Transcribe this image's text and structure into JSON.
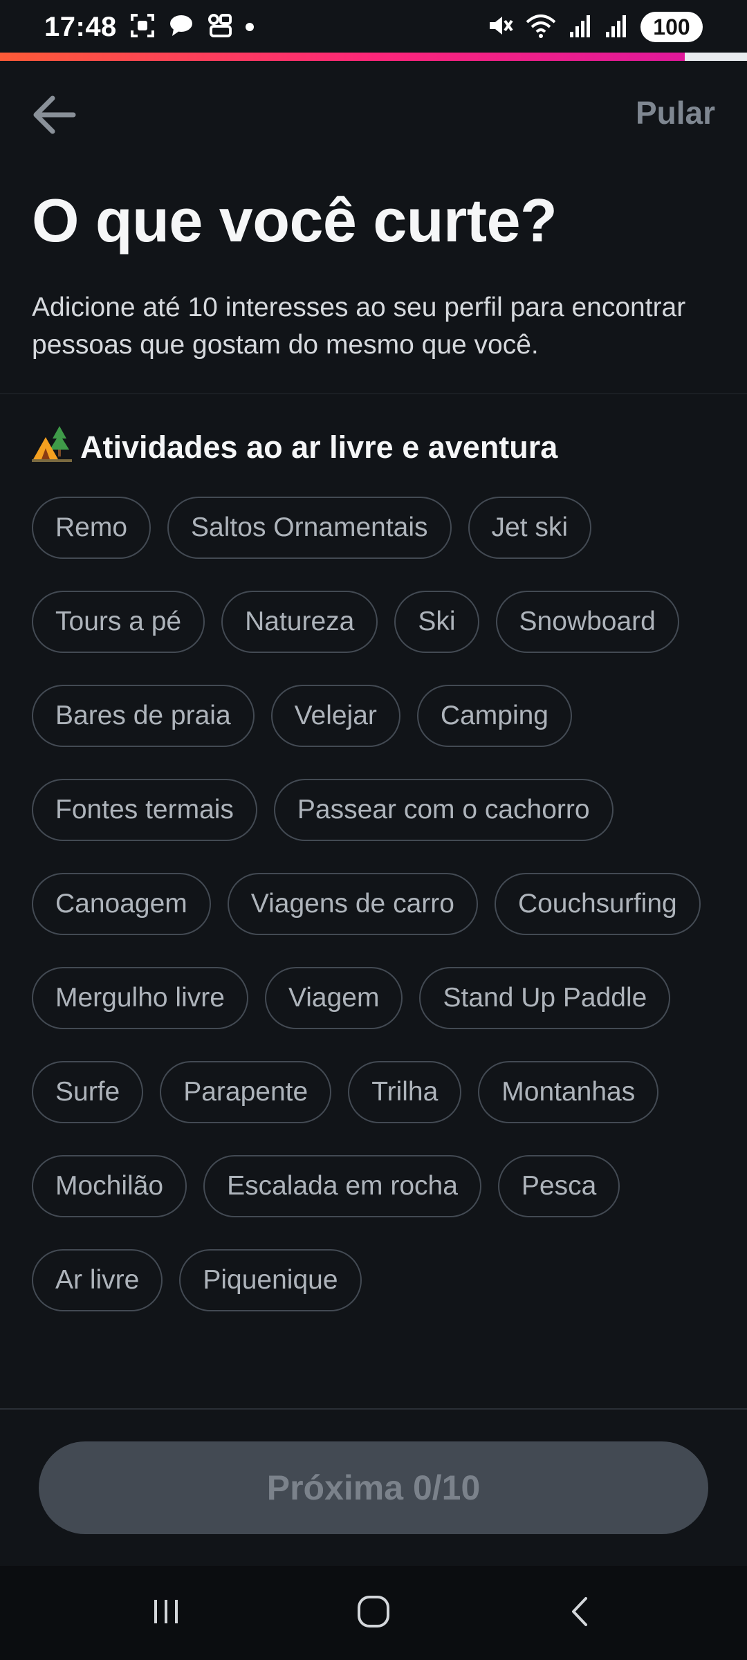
{
  "status_bar": {
    "time": "17:48",
    "battery": "100",
    "icons": [
      "screenshot-icon",
      "chat-bubble-icon",
      "app-switch-icon",
      "mute-icon",
      "wifi-icon",
      "signal-icon",
      "signal-icon"
    ]
  },
  "progress": {
    "fraction": 0.917
  },
  "header": {
    "back_icon": "arrow-left-icon",
    "skip_label": "Pular",
    "title": "O que você curte?",
    "subtitle": "Adicione até 10 interesses ao seu perfil para encontrar pessoas que gostam do mesmo que você."
  },
  "section": {
    "emoji": "camping-icon",
    "heading": "Atividades ao ar livre e aventura",
    "chips": [
      "Remo",
      "Saltos Ornamentais",
      "Jet ski",
      "Tours a pé",
      "Natureza",
      "Ski",
      "Snowboard",
      "Bares de praia",
      "Velejar",
      "Camping",
      "Fontes termais",
      "Passear com o cachorro",
      "Canoagem",
      "Viagens de carro",
      "Couchsurfing",
      "Mergulho livre",
      "Viagem",
      "Stand Up Paddle",
      "Surfe",
      "Parapente",
      "Trilha",
      "Montanhas",
      "Mochilão",
      "Escalada em rocha",
      "Pesca",
      "Ar livre",
      "Piquenique"
    ]
  },
  "footer": {
    "next_label": "Próxima 0/10"
  },
  "colors": {
    "background": "#111418",
    "chip_border": "#434a53",
    "chip_text": "#aeb4bb",
    "progress_gradient": [
      "#fd5b37",
      "#fd267a",
      "#e0189a"
    ],
    "button_disabled": "#434a53"
  },
  "nav_bar": {
    "icons": [
      "recent-apps-icon",
      "home-icon",
      "back-icon"
    ]
  }
}
